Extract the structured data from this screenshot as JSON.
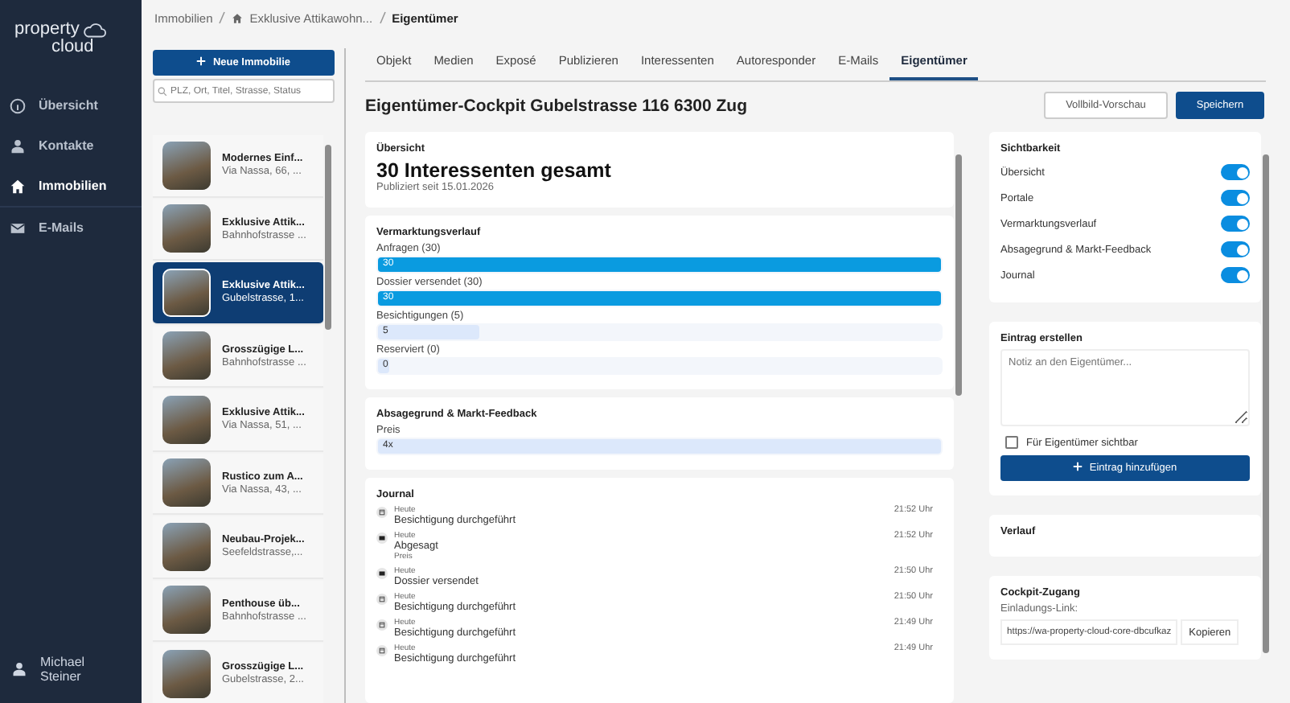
{
  "app": {
    "logo_line_1": "property",
    "logo_line_2": "cloud"
  },
  "nav": [
    {
      "label": "Übersicht",
      "selected": false
    },
    {
      "label": "Kontakte",
      "selected": false
    },
    {
      "label": "Immobilien",
      "selected": true
    },
    {
      "label": "E-Mails",
      "selected": false
    }
  ],
  "user": {
    "name": "Michael Steiner"
  },
  "breadcrumb": [
    {
      "label": "Immobilien",
      "kind": "link"
    },
    {
      "label": "Exklusive Attikawohn...",
      "kind": "home"
    },
    {
      "label": "Eigentümer",
      "kind": "current"
    }
  ],
  "property_list": {
    "new_button": "Neue Immobilie",
    "search": {
      "placeholder": "PLZ, Ort, Titel, Strasse, Status"
    },
    "items": [
      {
        "title": "Modernes Einf...",
        "address": "Via Nassa, 66, ...",
        "selected": false
      },
      {
        "title": "Exklusive Attik...",
        "address": "Bahnhofstrasse ...",
        "selected": false
      },
      {
        "title": "Exklusive Attik...",
        "address": "Gubelstrasse, 1...",
        "selected": true
      },
      {
        "title": "Grosszügige L...",
        "address": "Bahnhofstrasse ...",
        "selected": false
      },
      {
        "title": "Exklusive Attik...",
        "address": "Via Nassa, 51, ...",
        "selected": false
      },
      {
        "title": "Rustico zum A...",
        "address": "Via Nassa, 43, ...",
        "selected": false
      },
      {
        "title": "Neubau-Projek...",
        "address": "Seefeldstrasse,...",
        "selected": false
      },
      {
        "title": "Penthouse üb...",
        "address": "Bahnhofstrasse ...",
        "selected": false
      },
      {
        "title": "Grosszügige L...",
        "address": "Gubelstrasse, 2...",
        "selected": false
      }
    ]
  },
  "tabs": [
    {
      "label": "Objekt",
      "selected": false
    },
    {
      "label": "Medien",
      "selected": false
    },
    {
      "label": "Exposé",
      "selected": false
    },
    {
      "label": "Publizieren",
      "selected": false
    },
    {
      "label": "Interessenten",
      "selected": false
    },
    {
      "label": "Autoresponder",
      "selected": false
    },
    {
      "label": "E-Mails",
      "selected": false
    },
    {
      "label": "Eigentümer",
      "selected": true
    }
  ],
  "page": {
    "title": "Eigentümer-Cockpit Gubelstrasse 116 6300 Zug",
    "buttons": [
      {
        "label": "Vollbild-Vorschau",
        "kind": "secondary"
      },
      {
        "label": "Speichern",
        "kind": "primary"
      }
    ]
  },
  "overview": {
    "heading": "Übersicht",
    "total": "30 Interessenten gesamt",
    "published": "Publiziert seit 15.01.2026"
  },
  "marketing": {
    "heading": "Vermarktungsverlauf",
    "steps": [
      {
        "label": "Anfragen (30)",
        "value": "30",
        "level": 1
      },
      {
        "label": "Dossier versendet (30)",
        "value": "30",
        "level": 1
      },
      {
        "label": "Besichtigungen (5)",
        "value": "5",
        "level": 0.18
      },
      {
        "label": "Reserviert (0)",
        "value": "0",
        "level": 0
      }
    ]
  },
  "feedback": {
    "heading": "Absagegrund & Markt-Feedback",
    "reasons": [
      {
        "label": "Preis",
        "value": "4x",
        "level": 1
      }
    ]
  },
  "journal": {
    "heading": "Journal",
    "entries": [
      {
        "kind": "calendar",
        "day": "Heute",
        "title": "Besichtigung durchgeführt",
        "time": "21:52 Uhr"
      },
      {
        "kind": "mail",
        "day": "Heute",
        "title": "Abgesagt",
        "detail": "Preis",
        "time": "21:52 Uhr"
      },
      {
        "kind": "mail",
        "day": "Heute",
        "title": "Dossier versendet",
        "time": "21:50 Uhr"
      },
      {
        "kind": "calendar",
        "day": "Heute",
        "title": "Besichtigung durchgeführt",
        "time": "21:50 Uhr"
      },
      {
        "kind": "calendar",
        "day": "Heute",
        "title": "Besichtigung durchgeführt",
        "time": "21:49 Uhr"
      },
      {
        "kind": "calendar",
        "day": "Heute",
        "title": "Besichtigung durchgeführt",
        "time": "21:49 Uhr"
      }
    ]
  },
  "visibility": {
    "heading": "Sichtbarkeit",
    "toggles": [
      {
        "label": "Übersicht",
        "on": true
      },
      {
        "label": "Portale",
        "on": true
      },
      {
        "label": "Vermarktungsverlauf",
        "on": true
      },
      {
        "label": "Absagegrund & Markt-Feedback",
        "on": true
      },
      {
        "label": "Journal",
        "on": true
      }
    ]
  },
  "new_entry": {
    "heading": "Eintrag erstellen",
    "placeholder": "Notiz an den Eigentümer...",
    "owner_visible": {
      "label": "Für Eigentümer sichtbar",
      "checked": false
    },
    "button": "Eintrag hinzufügen"
  },
  "history": {
    "heading": "Verlauf"
  },
  "cockpit_access": {
    "heading": "Cockpit-Zugang",
    "link_label": "Einladungs-Link:",
    "link": "https://wa-property-cloud-core-dbcufkaz",
    "copy_button": "Kopieren"
  }
}
